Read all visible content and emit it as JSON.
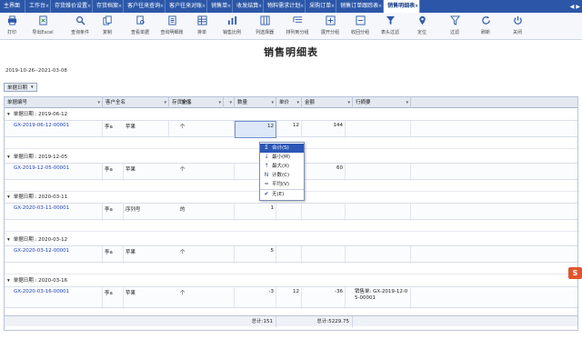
{
  "tabs": [
    {
      "label": "主界面"
    },
    {
      "label": "工作台"
    },
    {
      "label": "存货维价设置"
    },
    {
      "label": "存货档案"
    },
    {
      "label": "客户往来查询"
    },
    {
      "label": "客户往来对账"
    },
    {
      "label": "销售单"
    },
    {
      "label": "收发结算"
    },
    {
      "label": "物料需求计划"
    },
    {
      "label": "采购订单"
    },
    {
      "label": "销售订单跟踪表"
    },
    {
      "label": "销售明细表"
    }
  ],
  "tab_nav": {
    "prev": "◀",
    "next": "▶"
  },
  "toolbar": {
    "items": [
      {
        "label": "打印",
        "icon": "printer-icon"
      },
      {
        "label": "导出Excel",
        "icon": "export-excel-icon"
      },
      {
        "label": "查询条件",
        "icon": "search-icon"
      },
      {
        "label": "复制",
        "icon": "copy-icon"
      },
      {
        "label": "查看单据",
        "icon": "view-document-icon"
      },
      {
        "label": "查询明细账",
        "icon": "ledger-icon"
      },
      {
        "label": "排单",
        "icon": "grid-icon"
      },
      {
        "label": "销售比例",
        "icon": "ratio-icon"
      },
      {
        "label": "列选择器",
        "icon": "column-chooser-icon"
      },
      {
        "label": "排列到分组",
        "icon": "group-icon"
      },
      {
        "label": "展开分组",
        "icon": "expand-group-icon"
      },
      {
        "label": "收回分组",
        "icon": "collapse-group-icon"
      },
      {
        "label": "表头过滤",
        "icon": "filter-icon"
      },
      {
        "label": "定位",
        "icon": "locate-icon"
      },
      {
        "label": "过滤",
        "icon": "funnel-icon"
      },
      {
        "label": "刷新",
        "icon": "refresh-icon"
      },
      {
        "label": "关闭",
        "icon": "power-icon"
      }
    ]
  },
  "report": {
    "title": "销售明细表",
    "date_range": "2019-10-26--2021-03-08",
    "group_by": "单据日期"
  },
  "columns": [
    "单据编号",
    "客户全名",
    "存货全名",
    "单位",
    "数量",
    "单价",
    "金额",
    "行摘要"
  ],
  "groups": [
    {
      "header": "单据日期 : 2019-06-12",
      "doc_no": "GX-2019-06-12-00001",
      "customer": "李a",
      "item": "苹果",
      "unit": "个",
      "qty": "12",
      "price": "12",
      "amount": "144",
      "memo": ""
    },
    {
      "header": "单据日期 : 2019-12-05",
      "doc_no": "GX-2019-12-05-00001",
      "customer": "李a",
      "item": "苹果",
      "unit": "个",
      "qty": "",
      "price": "",
      "amount": "60",
      "memo": ""
    },
    {
      "header": "单据日期 : 2020-03-11",
      "doc_no": "GX-2020-03-11-00001",
      "customer": "李a",
      "item": "序列号",
      "unit": "的",
      "qty": "1",
      "price": "",
      "amount": "",
      "memo": ""
    },
    {
      "header": "单据日期 : 2020-03-12",
      "doc_no": "GX-2020-03-12-00001",
      "customer": "李a",
      "item": "苹果",
      "unit": "个",
      "qty": "5",
      "price": "",
      "amount": "",
      "memo": ""
    },
    {
      "header": "单据日期 : 2020-03-16",
      "doc_no": "GX-2020-03-16-00001",
      "customer": "李a",
      "item": "苹果",
      "unit": "个",
      "qty": "-3",
      "price": "12",
      "amount": "-36",
      "memo": "销售单: GX-2019-12-05-00001"
    }
  ],
  "footer": {
    "qty_total": "总计:151",
    "amount_total": "总计:5229.75"
  },
  "context_menu": {
    "items": [
      {
        "label": "合计(S)",
        "icon": "sum-icon",
        "highlighted": true
      },
      {
        "label": "最小(M)",
        "icon": "min-icon"
      },
      {
        "label": "最大(X)",
        "icon": "max-icon"
      },
      {
        "label": "计数(C)",
        "icon": "count-icon"
      },
      {
        "label": "平均(V)",
        "icon": "average-icon"
      },
      {
        "label": "无(E)",
        "icon": "checkmark-icon",
        "checked": true
      }
    ]
  },
  "logo_text": "S",
  "colors": {
    "tab_bar": "#2c57a8",
    "link": "#1f3fb5",
    "menu_highlight": "#2b57b6",
    "logo": "#e0552d"
  }
}
